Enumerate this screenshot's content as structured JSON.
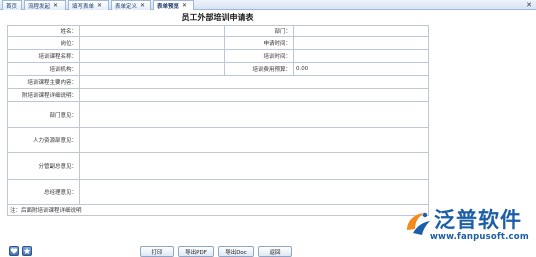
{
  "tabs": [
    {
      "label": "首页",
      "closable": false
    },
    {
      "label": "流程发起",
      "closable": true
    },
    {
      "label": "填写表单",
      "closable": true
    },
    {
      "label": "表单定义",
      "closable": true
    },
    {
      "label": "表单预览",
      "closable": true,
      "active": true
    }
  ],
  "tab_close_symbol": "✕",
  "close_all_symbol": "✕",
  "form": {
    "title": "员工外部培训申请表",
    "fields": {
      "name": {
        "label": "姓名：",
        "value": ""
      },
      "dept": {
        "label": "部门：",
        "value": ""
      },
      "position": {
        "label": "岗位：",
        "value": ""
      },
      "apply_time": {
        "label": "申请时间：",
        "value": ""
      },
      "course_name": {
        "label": "培训课程名称：",
        "value": ""
      },
      "train_time": {
        "label": "培训时间：",
        "value": ""
      },
      "institution": {
        "label": "培训机构：",
        "value": ""
      },
      "budget": {
        "label": "培训费用预算：",
        "value": "0.00"
      },
      "main_content": {
        "label": "培训课程主要内容：",
        "value": ""
      },
      "attachment": {
        "label": "附培训课程详细说明：",
        "value": ""
      },
      "dept_opinion": {
        "label": "部门意见：",
        "value": ""
      },
      "hr_opinion": {
        "label": "人力资源部意见：",
        "value": ""
      },
      "vp_opinion": {
        "label": "分管副总意见：",
        "value": ""
      },
      "gm_opinion": {
        "label": "总经理意见：",
        "value": ""
      }
    },
    "note": "注：后面附培训课程详细说明"
  },
  "buttons": {
    "print": "打印",
    "export_pdf": "导出PDF",
    "export_doc": "导出Doc",
    "back": "返回"
  },
  "logo": {
    "name": "泛普软件",
    "url": "www.fanpusoft.com"
  },
  "colors": {
    "brand_blue": "#1c5ea8",
    "logo_orange": "#f28a1c",
    "border": "#bcc8d8"
  }
}
